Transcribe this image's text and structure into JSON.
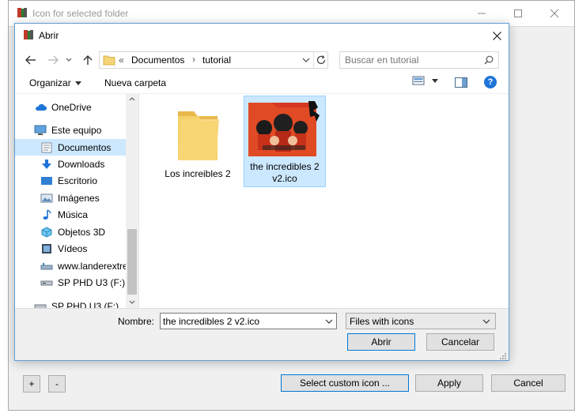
{
  "outer_window": {
    "title": "Icon for selected folder",
    "buttons": {
      "add": "+",
      "remove": "-",
      "select_custom_icon": "Select custom icon ...",
      "apply": "Apply",
      "cancel": "Cancel"
    }
  },
  "dialog": {
    "title": "Abrir",
    "address": {
      "prefix": "«",
      "crumbs": [
        "Documentos",
        "tutorial"
      ]
    },
    "search_placeholder": "Buscar en tutorial",
    "toolbar": {
      "organize": "Organizar",
      "new_folder": "Nueva carpeta"
    },
    "nav_items": [
      {
        "label": "OneDrive",
        "icon": "cloud-icon"
      },
      {
        "label": "Este equipo",
        "icon": "computer-icon"
      },
      {
        "label": "Documentos",
        "icon": "document-folder-icon",
        "selected": true
      },
      {
        "label": "Downloads",
        "icon": "download-arrow-icon"
      },
      {
        "label": "Escritorio",
        "icon": "desktop-icon"
      },
      {
        "label": "Imágenes",
        "icon": "pictures-icon"
      },
      {
        "label": "Música",
        "icon": "music-note-icon"
      },
      {
        "label": "Objetos 3D",
        "icon": "cube-3d-icon"
      },
      {
        "label": "Vídeos",
        "icon": "video-icon"
      },
      {
        "label": "www.landerextre",
        "icon": "network-drive-icon"
      },
      {
        "label": "SP PHD U3 (F:)",
        "icon": "usb-drive-icon"
      },
      {
        "label": "SP PHD U3 (F:)",
        "icon": "usb-drive-icon"
      }
    ],
    "files": [
      {
        "label": "Los increibles 2",
        "icon": "folder-icon"
      },
      {
        "label": "the incredibles 2 v2.ico",
        "icon": "incredibles-thumbnail-icon",
        "selected": true
      }
    ],
    "name_label": "Nombre:",
    "name_value": "the incredibles 2 v2.ico",
    "file_type": "Files with icons",
    "open_button": "Abrir",
    "cancel_button": "Cancelar"
  },
  "colors": {
    "accent": "#0078d7",
    "selection": "#cce8ff",
    "selection_border": "#99d1ff",
    "help_blue": "#1e74d8"
  }
}
